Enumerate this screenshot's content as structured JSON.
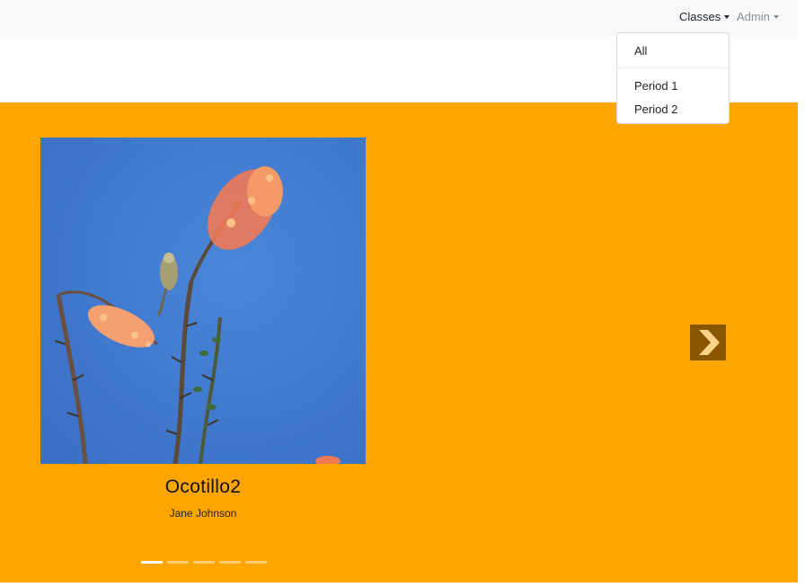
{
  "navbar": {
    "classes_label": "Classes",
    "admin_label": "Admin"
  },
  "classes_menu": {
    "items": [
      {
        "label": "All"
      },
      {
        "label": "Period 1"
      },
      {
        "label": "Period 2"
      }
    ]
  },
  "carousel": {
    "active_slide": {
      "title": "Ocotillo2",
      "author": "Jane Johnson",
      "image_description": "ocotillo-bird-photo"
    },
    "slide_count": 5,
    "active_index": 0,
    "next_icon": "chevron-right-icon"
  },
  "colors": {
    "navbar_bg": "#f8f9fa",
    "hero_bg": "#ffa500",
    "control_bg": "#8a5600",
    "sky": "#3f78cc"
  }
}
